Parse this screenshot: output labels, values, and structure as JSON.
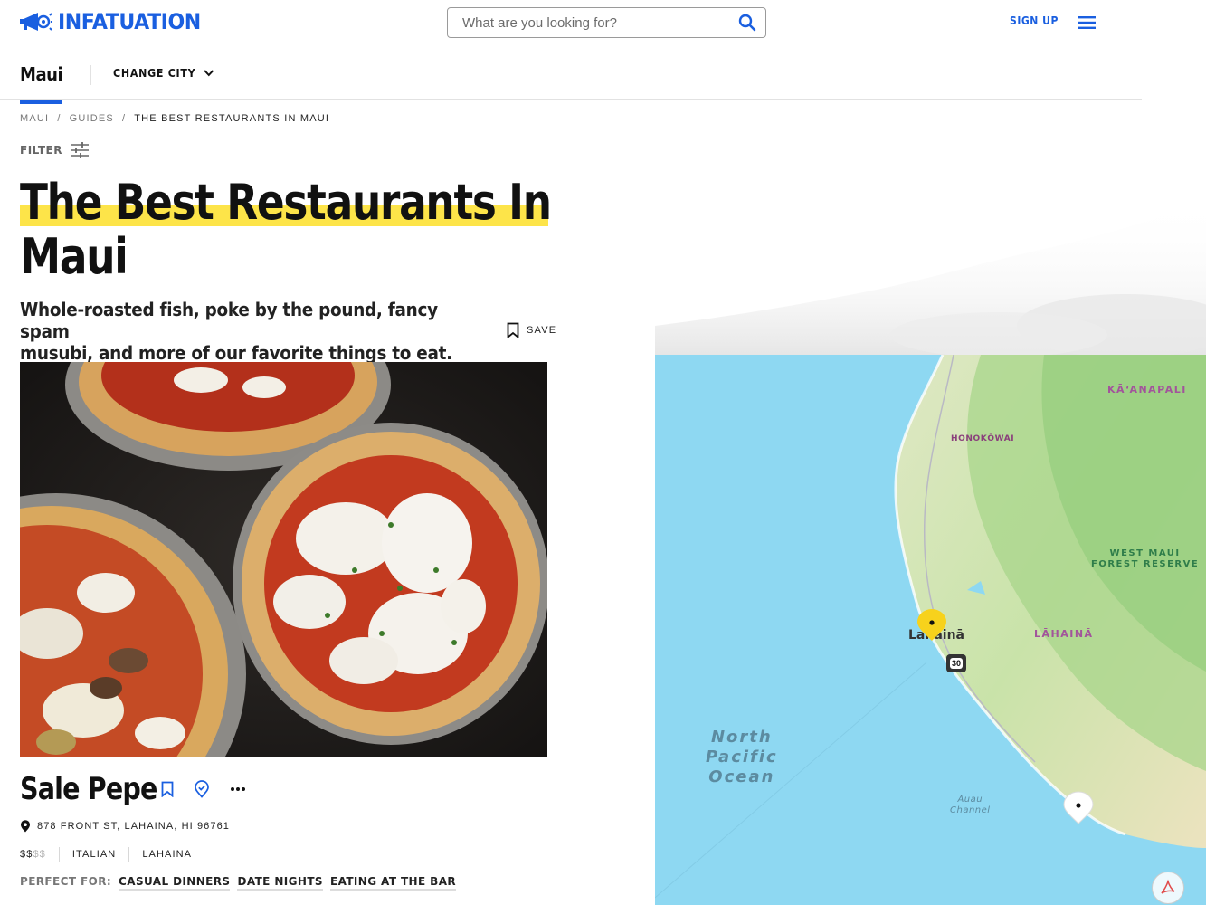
{
  "header": {
    "brand": "INFATUATION",
    "search_placeholder": "What are you looking for?",
    "signup_label": "SIGN UP"
  },
  "city_bar": {
    "city": "Maui",
    "change_city_label": "CHANGE CITY"
  },
  "breadcrumb": {
    "items": [
      "MAUI",
      "GUIDES",
      "THE BEST RESTAURANTS IN MAUI"
    ],
    "separator": "/"
  },
  "filter_label": "FILTER",
  "guide": {
    "title_line1": "The Best Restaurants In",
    "title_line2": "Maui",
    "subtitle_line1": "Whole-roasted fish, poke by the pound, fancy spam",
    "subtitle_line2": "musubi, and more of our favorite things to eat.",
    "save_label": "SAVE"
  },
  "restaurant": {
    "name": "Sale Pepe",
    "address": "878 FRONT ST, LAHAINA, HI 96761",
    "price_active": "$$",
    "price_inactive": "$$",
    "cuisine": "ITALIAN",
    "neighborhood": "LAHAINA",
    "perfect_for_label": "PERFECT FOR:",
    "perfect_for": [
      "CASUAL DINNERS",
      "DATE NIGHTS",
      "EATING AT THE BAR"
    ]
  },
  "map": {
    "labels": {
      "kaanapali": "KĀʻANAPALI",
      "honokowai": "HONOKŌWAI",
      "forest_line1": "WEST MAUI",
      "forest_line2": "FOREST RESERVE",
      "lahaina_region": "LĀHAINĀ",
      "lahaina_town": "Lahainā",
      "highway": "30",
      "ocean_line1": "North",
      "ocean_line2": "Pacific",
      "ocean_line3": "Ocean",
      "channel_line1": "Auau",
      "channel_line2": "Channel"
    }
  },
  "colors": {
    "brand_blue": "#1a5fe0",
    "highlight_yellow": "#fde449",
    "ocean": "#8ed8f2",
    "pin_yellow": "#f7d21c"
  }
}
